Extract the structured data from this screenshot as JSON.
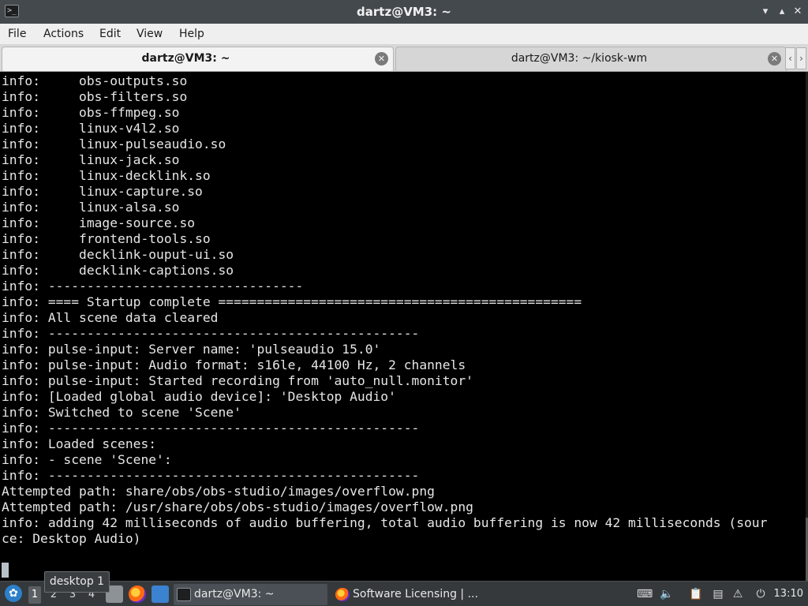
{
  "window": {
    "title": "dartz@VM3: ~",
    "app_icon": ">_"
  },
  "menu": [
    "File",
    "Actions",
    "Edit",
    "View",
    "Help"
  ],
  "tabs": [
    {
      "label": "dartz@VM3: ~",
      "active": true
    },
    {
      "label": "dartz@VM3: ~/kiosk-wm",
      "active": false
    }
  ],
  "terminal": {
    "lines": [
      "info:     obs-outputs.so",
      "info:     obs-filters.so",
      "info:     obs-ffmpeg.so",
      "info:     linux-v4l2.so",
      "info:     linux-pulseaudio.so",
      "info:     linux-jack.so",
      "info:     linux-decklink.so",
      "info:     linux-capture.so",
      "info:     linux-alsa.so",
      "info:     image-source.so",
      "info:     frontend-tools.so",
      "info:     decklink-ouput-ui.so",
      "info:     decklink-captions.so",
      "info: ---------------------------------",
      "info: ==== Startup complete ===============================================",
      "info: All scene data cleared",
      "info: ------------------------------------------------",
      "info: pulse-input: Server name: 'pulseaudio 15.0'",
      "info: pulse-input: Audio format: s16le, 44100 Hz, 2 channels",
      "info: pulse-input: Started recording from 'auto_null.monitor'",
      "info: [Loaded global audio device]: 'Desktop Audio'",
      "info: Switched to scene 'Scene'",
      "info: ------------------------------------------------",
      "info: Loaded scenes:",
      "info: - scene 'Scene':",
      "info: ------------------------------------------------",
      "Attempted path: share/obs/obs-studio/images/overflow.png",
      "Attempted path: /usr/share/obs/obs-studio/images/overflow.png",
      "info: adding 42 milliseconds of audio buffering, total audio buffering is now 42 milliseconds (sour",
      "ce: Desktop Audio)",
      ""
    ]
  },
  "tooltip": "desktop 1",
  "taskbar": {
    "workspaces": [
      "1",
      "2",
      "3",
      "4"
    ],
    "tasks": [
      {
        "label": "dartz@VM3: ~",
        "icon": "terminal-icon",
        "active": true
      },
      {
        "label": "Software Licensing | ...",
        "icon": "firefox-icon",
        "active": false
      }
    ],
    "clock": "13:10"
  },
  "colors": {
    "titlebar": "#44494e",
    "terminal_bg": "#000000",
    "terminal_fg": "#e6e6e6",
    "taskbar": "#35393c",
    "accent": "#2d7fc9"
  }
}
